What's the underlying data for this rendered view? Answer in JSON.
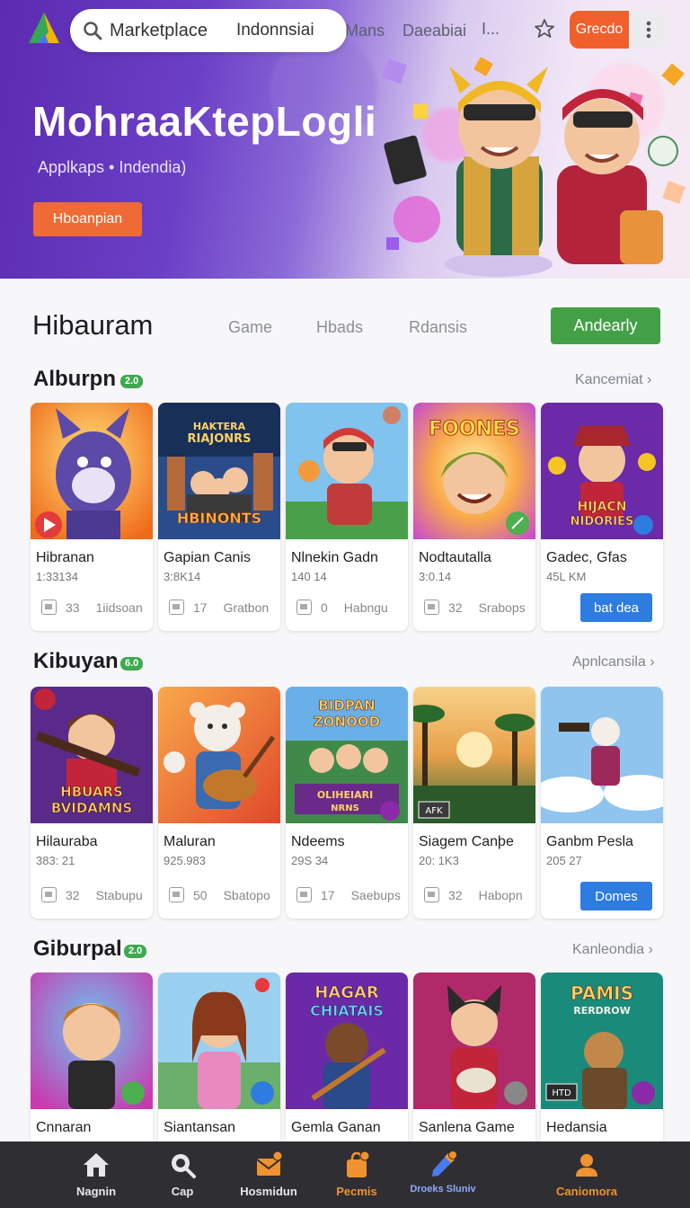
{
  "header": {
    "search_label": "Marketplace",
    "search_region": "Indonnsiai",
    "nav": [
      "Mans",
      "Daeabiai",
      "I..."
    ],
    "action_button": "Grecdo"
  },
  "hero": {
    "title": "MohraaKtepLogli",
    "subtitle": "Applkaps • Indendia)",
    "button": "Hboanpian"
  },
  "main": {
    "title": "Hibauram",
    "tabs": [
      "Game",
      "Hbads",
      "Rdansis"
    ],
    "primary_button": "Andearly"
  },
  "sections": [
    {
      "title": "Alburpn",
      "badge": "2.0",
      "more": "Kancemiat",
      "button": "bat dea",
      "cards": [
        {
          "name": "Hibranan",
          "sub": "1:33134",
          "count": "33",
          "tag": "1iidsoan",
          "thumb_text": ""
        },
        {
          "name": "Gapian Canis",
          "sub": "3:8K14",
          "count": "17",
          "tag": "Gratbon",
          "thumb_text": "HAKTERA RIAJONRS HBINONTS"
        },
        {
          "name": "Nlnekin Gadn",
          "sub": "140 14",
          "count": "0",
          "tag": "Habngu",
          "thumb_text": ""
        },
        {
          "name": "Nodtautalla",
          "sub": "3:0.14",
          "count": "32",
          "tag": "Srabops",
          "thumb_text": "FOONES"
        },
        {
          "name": "Gadec, Gfas",
          "sub": "45L KM",
          "count": "",
          "tag": "",
          "thumb_text": "HIJACN NIDORIES"
        }
      ]
    },
    {
      "title": "Kibuyan",
      "badge": "6.0",
      "more": "Apnlcansila",
      "button": "Domes",
      "cards": [
        {
          "name": "Hilauraba",
          "sub": "383: 21",
          "count": "32",
          "tag": "Stabupu",
          "thumb_text": "HBUARS BVIDAMNS"
        },
        {
          "name": "Maluran",
          "sub": "925.983",
          "count": "50",
          "tag": "Sbatopo",
          "thumb_text": ""
        },
        {
          "name": "Ndeems",
          "sub": "29S 34",
          "count": "17",
          "tag": "Saebups",
          "thumb_text": "BIDPAN ZONOOD OLIHEIARI NRNS"
        },
        {
          "name": "Siagem Canþe",
          "sub": "20: 1K3",
          "count": "32",
          "tag": "Habopn",
          "thumb_text": "AFK"
        },
        {
          "name": "Ganbm Pesla",
          "sub": "205 27",
          "count": "",
          "tag": "",
          "thumb_text": ""
        }
      ]
    },
    {
      "title": "Giburpal",
      "badge": "2.0",
      "more": "Kanleondia",
      "cards": [
        {
          "name": "Cnnaran",
          "thumb_text": ""
        },
        {
          "name": "Siantansan",
          "thumb_text": ""
        },
        {
          "name": "Gemla Ganan",
          "thumb_text": "HAGAR CHIATAIS"
        },
        {
          "name": "Sanlena Game",
          "thumb_text": ""
        },
        {
          "name": "Hedansia",
          "thumb_text": "PAMIS RERDROW HTD"
        }
      ]
    }
  ],
  "bottom_nav": [
    {
      "label": "Nagnin",
      "icon": "home-icon",
      "color": "#e8e8ea"
    },
    {
      "label": "Cap",
      "icon": "search-icon",
      "color": "#e8e8ea"
    },
    {
      "label": "Hosmidun",
      "icon": "mail-icon",
      "color": "#e8e8ea"
    },
    {
      "label": "Pecmis",
      "icon": "bag-icon",
      "color": "#f0922f"
    },
    {
      "label": "Droeks Sluniv",
      "icon": "pen-icon",
      "color": "#8ea8ff"
    },
    {
      "label": "Caniomora",
      "icon": "user-icon",
      "color": "#f0922f"
    }
  ],
  "colors": {
    "accent_orange": "#f1602c",
    "accent_green": "#43a047",
    "accent_blue": "#2f7ce0",
    "hero_purple": "#5b2bb0"
  }
}
